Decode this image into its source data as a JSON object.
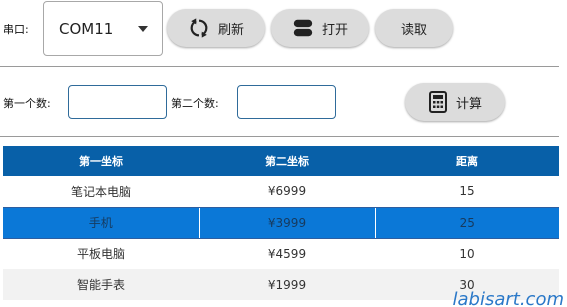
{
  "port": {
    "label": "串口:",
    "selected": "COM11"
  },
  "toolbar": {
    "refresh": "刷新",
    "open": "打开",
    "read": "读取"
  },
  "calc": {
    "first_label": "第一个数:",
    "second_label": "第二个数:",
    "first_value": "",
    "second_value": "",
    "compute": "计算"
  },
  "table": {
    "headers": [
      "第一坐标",
      "第二坐标",
      "距离"
    ],
    "rows": [
      [
        "笔记本电脑",
        "¥6999",
        "15"
      ],
      [
        "手机",
        "¥3999",
        "25"
      ],
      [
        "平板电脑",
        "¥4599",
        "10"
      ],
      [
        "智能手表",
        "¥1999",
        "30"
      ]
    ],
    "selected_row": 1
  },
  "watermark": "labisart.com",
  "colors": {
    "header": "#0860a8",
    "selected": "#0b78d7",
    "button": "#dcdcdc"
  },
  "icons": {
    "refresh": "refresh-icon",
    "open": "toggle-icon",
    "compute": "calculator-icon"
  }
}
